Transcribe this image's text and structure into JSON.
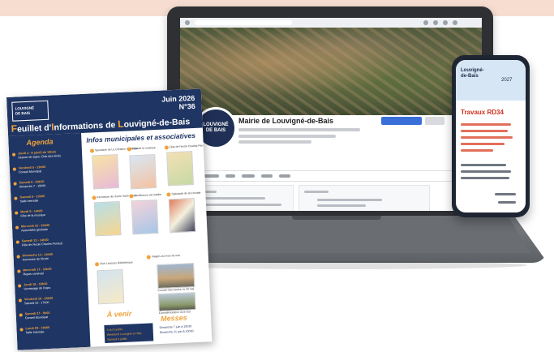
{
  "laptop": {
    "page_name": "Mairie de Louvigné-de-Bais",
    "profile_logo_line1": "LOUVIGNÉ",
    "profile_logo_line2": "DE BAIS"
  },
  "phone": {
    "logo_line1": "Louvigné-",
    "logo_line2": "de-Bais",
    "date": "2027",
    "headline": "Travaux RD34"
  },
  "newsletter": {
    "logo_line1": "LOUVIGNÉ",
    "logo_line2": "DE BAIS",
    "date_line1": "Juin 2026",
    "date_line2": "N°36",
    "title_prefix": "euillet d'",
    "title_F": "F",
    "title_I": "I",
    "title_mid": "nformations de ",
    "title_L": "L",
    "title_end": "ouvigné-de-Bais",
    "agenda_heading": "Agenda",
    "infos_heading": "Infos municipales et associatives",
    "avenir_heading": "À venir",
    "messes_heading": "Messes",
    "agenda_items": [
      {
        "date": "Jeudi 4 - 8 juin/2 de 13h15",
        "desc": "Séance de signe: Club des Ainés"
      },
      {
        "date": "Vendredi 5 - 19h00",
        "desc": "Conseil Municipal"
      },
      {
        "date": "Samedi 6 - 20h30",
        "desc": "Dimanche 7 - 15h00"
      },
      {
        "date": "Samedi 6 - 10h00",
        "desc": "Salle Intercale"
      },
      {
        "date": "Mardi 9 - 14h00",
        "desc": "Fête de la musique"
      },
      {
        "date": "Mercredi 10 - 20h30",
        "desc": "Assemblée générale"
      },
      {
        "date": "Samedi 13 - 14h00",
        "desc": "Fête de l'école Charles Perrault"
      },
      {
        "date": "Dimanche 14 - 14h00",
        "desc": "Kermesse de l'école"
      },
      {
        "date": "Mercredi 17 - 12h00",
        "desc": "Repas convivial"
      },
      {
        "date": "Jeudi 18 - 18h30",
        "desc": "Vernissage de l'expo"
      },
      {
        "date": "Vendredi 19 - 20h30",
        "desc": "Samedi 20 - 17h00"
      },
      {
        "date": "Samedi 27 - 9h00",
        "desc": "Conseil Municipal"
      },
      {
        "date": "Lundi 29 - 19h00",
        "desc": "Salle Intercale"
      }
    ],
    "thumb_labels": [
      "Spectacle de La Création du Temps",
      "Fête de la musique",
      "Fête de l'école Charles Perrault",
      "Kermesse de l'école Saint-Pierre",
      "Conférence de l'atelier",
      "Spectacle de la Chorale",
      "Club Lectures Bibliothèque",
      "Images du mois de mai"
    ],
    "photo_captions": [
      "Concert des écoles, le 20 mai",
      "Commémoration du 8 mai"
    ],
    "avenir_lines": [
      "3 au 5 juillet",
      "Weekend Louvigné en fête",
      "Samedi 4 juillet"
    ],
    "messes_lines": [
      "Dimanche 7 juin à 10h30",
      "Dimanche 21 juin à 10h30"
    ]
  },
  "colors": {
    "navy": "#1f3563",
    "orange": "#f0a23b",
    "phone_red": "#d0301f",
    "peach": "#f6ddd0"
  }
}
